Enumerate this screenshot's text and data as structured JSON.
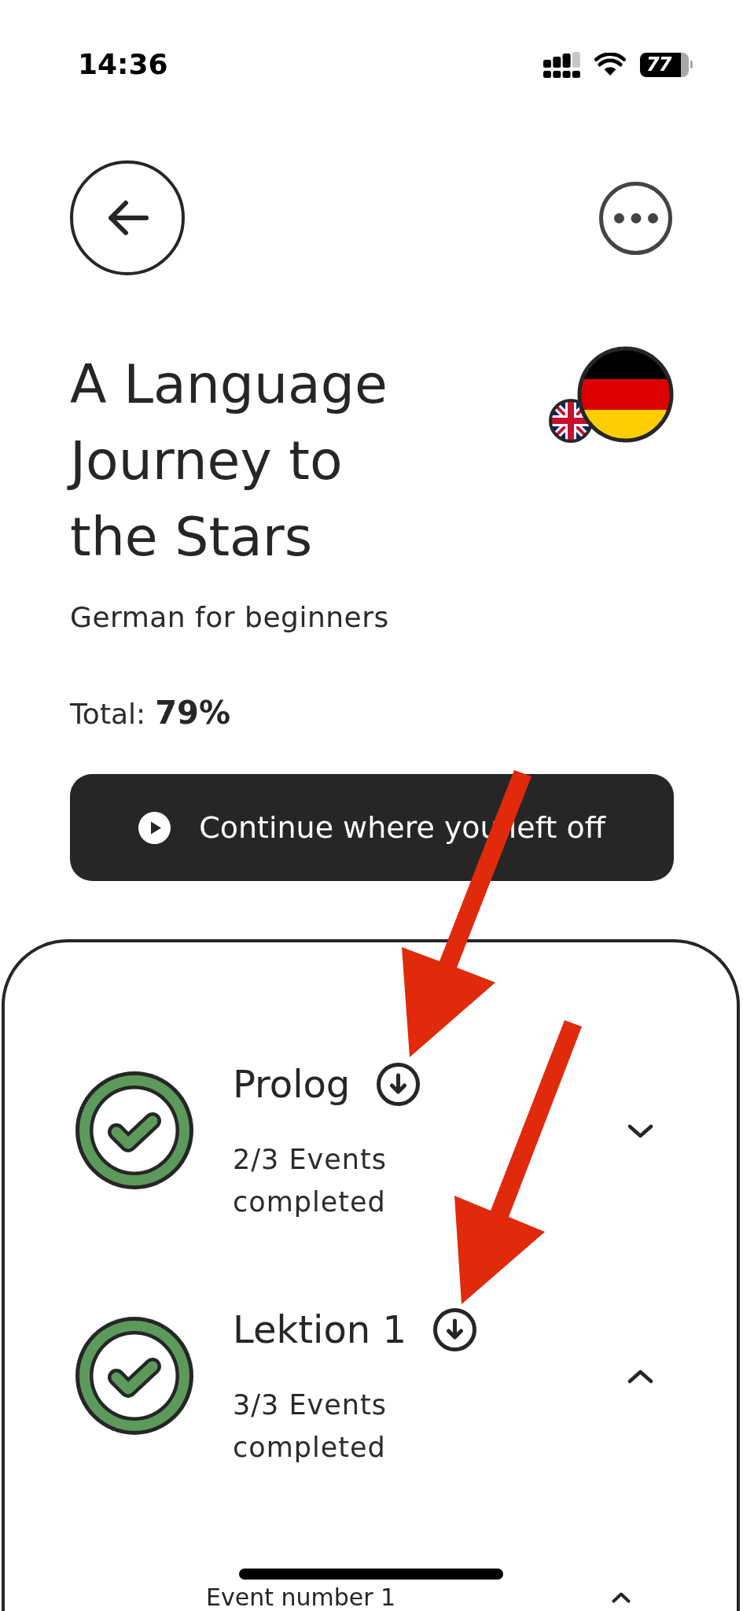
{
  "status_bar": {
    "time": "14:36",
    "battery": "77"
  },
  "course": {
    "title": "A Language Journey to the Stars",
    "subtitle": "German for beginners",
    "total_label": "Total:",
    "total_value": "79%"
  },
  "continue_button": {
    "label": "Continue where you left off"
  },
  "chapters": [
    {
      "title": "Prolog",
      "events_count": "2/3 Events completed",
      "completed": true,
      "expanded": false
    },
    {
      "title": "Lektion 1",
      "events_count": "3/3 Events completed",
      "completed": true,
      "expanded": true,
      "events": [
        {
          "title": "Event number 1"
        }
      ]
    }
  ]
}
